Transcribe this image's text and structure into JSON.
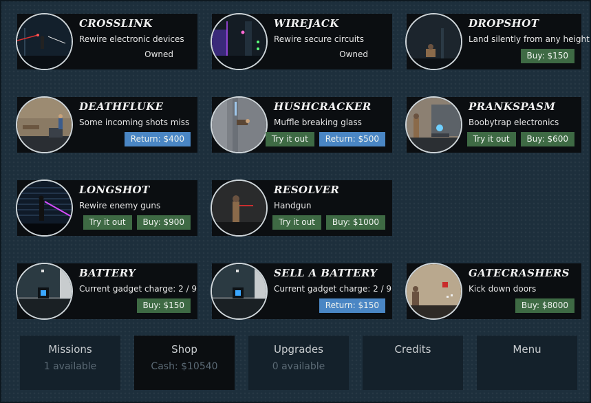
{
  "cards": [
    {
      "name": "CROSSLINK",
      "desc": "Rewire electronic devices",
      "owned": "Owned"
    },
    {
      "name": "WIREJACK",
      "desc": "Rewire secure circuits",
      "owned": "Owned"
    },
    {
      "name": "DROPSHOT",
      "desc": "Land silently from any height",
      "buy": "Buy: $150"
    },
    {
      "name": "DEATHFLUKE",
      "desc": "Some incoming shots miss",
      "ret": "Return: $400"
    },
    {
      "name": "HUSHCRACKER",
      "desc": "Muffle breaking glass",
      "try": "Try it out",
      "ret": "Return: $500"
    },
    {
      "name": "PRANKSPASM",
      "desc": "Boobytrap electronics",
      "try": "Try it out",
      "buy": "Buy: $600"
    },
    {
      "name": "LONGSHOT",
      "desc": "Rewire enemy guns",
      "try": "Try it out",
      "buy": "Buy: $900"
    },
    {
      "name": "RESOLVER",
      "desc": "Handgun",
      "try": "Try it out",
      "buy": "Buy: $1000"
    },
    {
      "name": "BATTERY",
      "desc": "Current gadget charge: 2 / 9",
      "buy": "Buy: $150"
    },
    {
      "name": "SELL A BATTERY",
      "desc": "Current gadget charge: 2 / 9",
      "ret": "Return: $150"
    },
    {
      "name": "GATECRASHERS",
      "desc": "Kick down doors",
      "buy": "Buy: $8000"
    }
  ],
  "nav": [
    {
      "label": "Missions",
      "sub": "1 available"
    },
    {
      "label": "Shop",
      "sub": "Cash: $10540"
    },
    {
      "label": "Upgrades",
      "sub": "0 available"
    },
    {
      "label": "Credits",
      "sub": ""
    },
    {
      "label": "Menu",
      "sub": ""
    }
  ]
}
